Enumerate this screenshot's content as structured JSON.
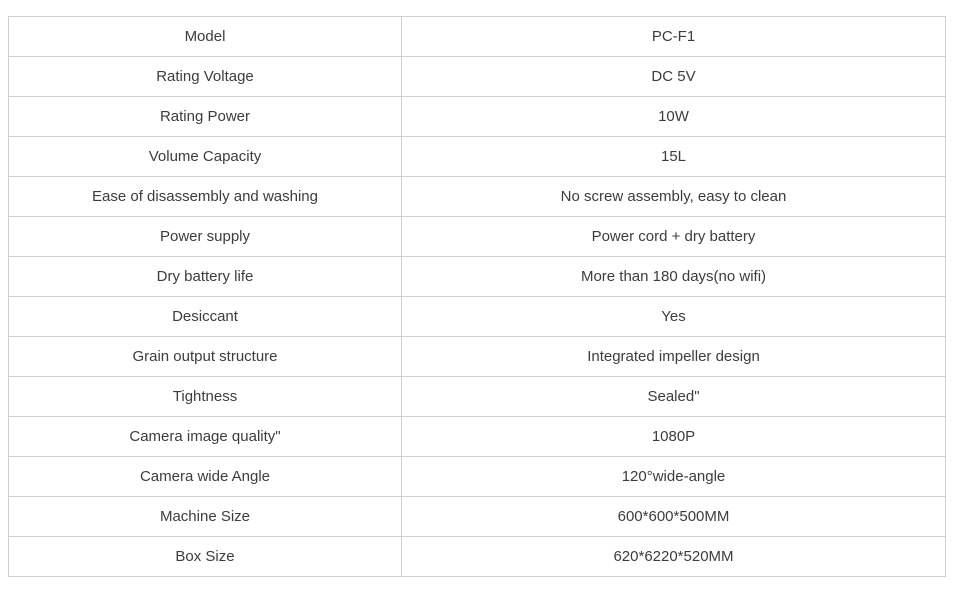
{
  "table": {
    "columns": [
      "",
      ""
    ],
    "rows": [
      {
        "label": "Model",
        "value": "PC-F1"
      },
      {
        "label": "Rating Voltage",
        "value": "DC 5V"
      },
      {
        "label": "Rating Power",
        "value": "10W"
      },
      {
        "label": "Volume Capacity",
        "value": "15L"
      },
      {
        "label": "Ease of disassembly and washing",
        "value": "No screw assembly, easy to clean"
      },
      {
        "label": "Power supply",
        "value": "Power cord + dry battery"
      },
      {
        "label": "Dry battery life",
        "value": "More than 180 days(no wifi)"
      },
      {
        "label": "Desiccant",
        "value": "Yes"
      },
      {
        "label": "Grain output structure",
        "value": "Integrated impeller design"
      },
      {
        "label": "Tightness",
        "value": "Sealed\""
      },
      {
        "label": "Camera image quality\"",
        "value": "1080P"
      },
      {
        "label": "Camera wide Angle",
        "value": "120°wide-angle"
      },
      {
        "label": "Machine Size",
        "value": "600*600*500MM"
      },
      {
        "label": "Box Size",
        "value": "620*6220*520MM"
      }
    ]
  },
  "style": {
    "border_color": "#cfcfcf",
    "text_color": "#3c3c3c",
    "background": "#ffffff"
  }
}
